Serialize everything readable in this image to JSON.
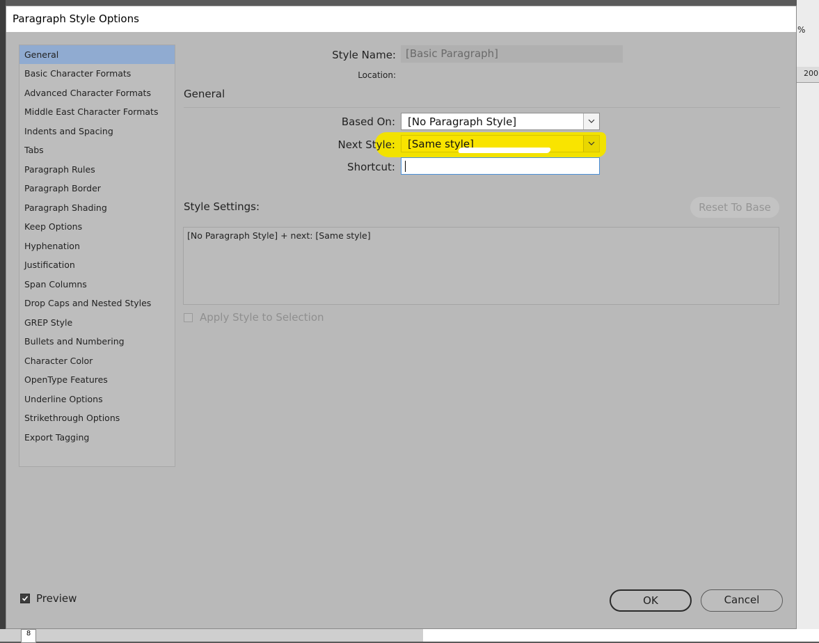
{
  "background": {
    "zoom_text": "%",
    "ruler_text": "200",
    "page_number_text": "8"
  },
  "dialog": {
    "title": "Paragraph Style Options",
    "categories": [
      {
        "label": "General",
        "selected": true
      },
      {
        "label": "Basic Character Formats"
      },
      {
        "label": "Advanced Character Formats"
      },
      {
        "label": "Middle East Character Formats"
      },
      {
        "label": "Indents and Spacing"
      },
      {
        "label": "Tabs"
      },
      {
        "label": "Paragraph Rules"
      },
      {
        "label": "Paragraph Border"
      },
      {
        "label": "Paragraph Shading"
      },
      {
        "label": "Keep Options"
      },
      {
        "label": "Hyphenation"
      },
      {
        "label": "Justification"
      },
      {
        "label": "Span Columns"
      },
      {
        "label": "Drop Caps and Nested Styles"
      },
      {
        "label": "GREP Style"
      },
      {
        "label": "Bullets and Numbering"
      },
      {
        "label": "Character Color"
      },
      {
        "label": "OpenType Features"
      },
      {
        "label": "Underline Options"
      },
      {
        "label": "Strikethrough Options"
      },
      {
        "label": "Export Tagging"
      }
    ],
    "general": {
      "style_name_label": "Style Name:",
      "style_name_value": "[Basic Paragraph]",
      "location_label": "Location:",
      "section_title": "General",
      "based_on_label": "Based On:",
      "based_on_value": "[No Paragraph Style]",
      "next_style_label": "Next Style:",
      "next_style_value": "[Same style]",
      "shortcut_label": "Shortcut:",
      "shortcut_value": "",
      "style_settings_label": "Style Settings:",
      "reset_button": "Reset To Base",
      "style_settings_text": "[No Paragraph Style] + next: [Same style]",
      "apply_style_label": "Apply Style to Selection",
      "apply_style_checked": false
    },
    "preview_label": "Preview",
    "preview_checked": true,
    "ok_button": "OK",
    "cancel_button": "Cancel",
    "colors": {
      "highlight": "#f9e400",
      "selected_category": "#90abd1",
      "dialog_bg": "#b9b9b9"
    }
  }
}
